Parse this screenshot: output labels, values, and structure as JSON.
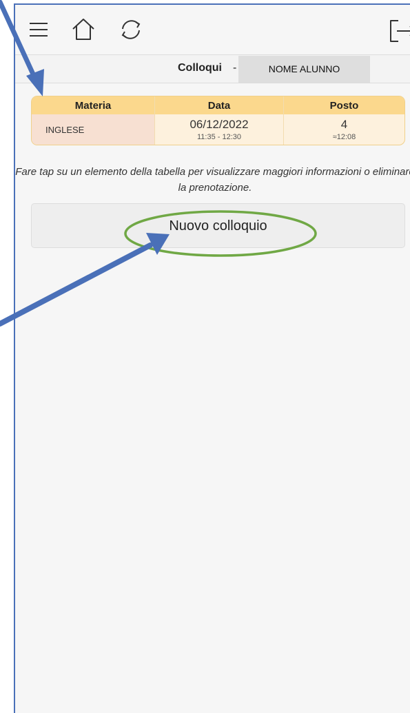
{
  "colors": {
    "accent_border": "#4a70b8",
    "table_header": "#fbd88d",
    "highlight": "#70a845"
  },
  "toolbar": {
    "menu_icon": "hamburger-menu-icon",
    "home_icon": "home-icon",
    "refresh_icon": "refresh-icon",
    "logout_icon": "logout-icon"
  },
  "header": {
    "title": "Colloqui",
    "separator": "-",
    "student_name": "NOME ALUNNO"
  },
  "table": {
    "columns": [
      "Materia",
      "Data",
      "Posto"
    ],
    "rows": [
      {
        "materia": "INGLESE",
        "date": "06/12/2022",
        "time": "11:35 - 12:30",
        "posto": "4",
        "approx_time": "≈12:08"
      }
    ]
  },
  "hint": "Fare tap su un elemento della tabella per visualizzare maggiori informazioni o eliminare la prenotazione.",
  "new_button": {
    "label": "Nuovo colloquio"
  }
}
